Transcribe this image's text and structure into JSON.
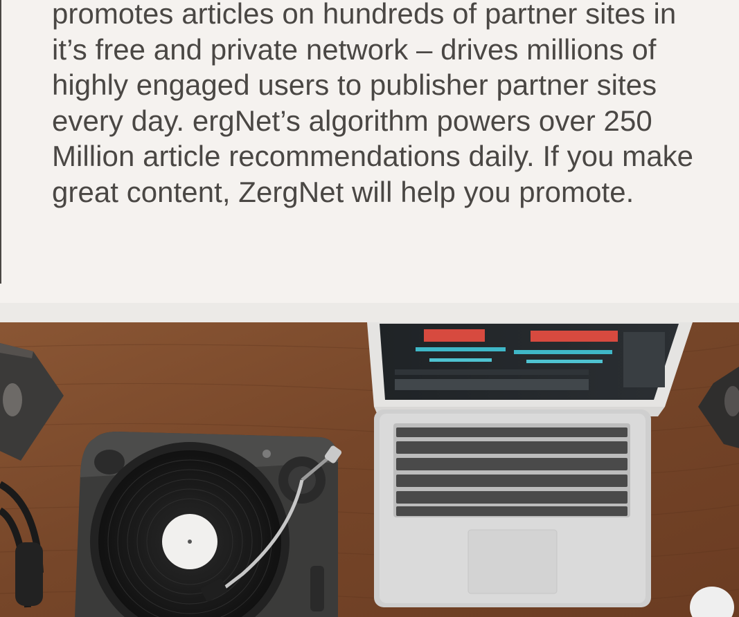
{
  "article": {
    "lines": [
      "promotes articles on hundreds of partner sites in",
      "it’s free and private network – drives millions of",
      "highly engaged users to publisher partner sites",
      "every day. ergNet’s algorithm powers over 250",
      "Million article recommendations daily. If you make",
      "great content, ZergNet will help you promote."
    ]
  },
  "colors": {
    "text": "#4a4744",
    "section_background": "#f5f2ef",
    "desk_wood": "#7a4a2c"
  }
}
